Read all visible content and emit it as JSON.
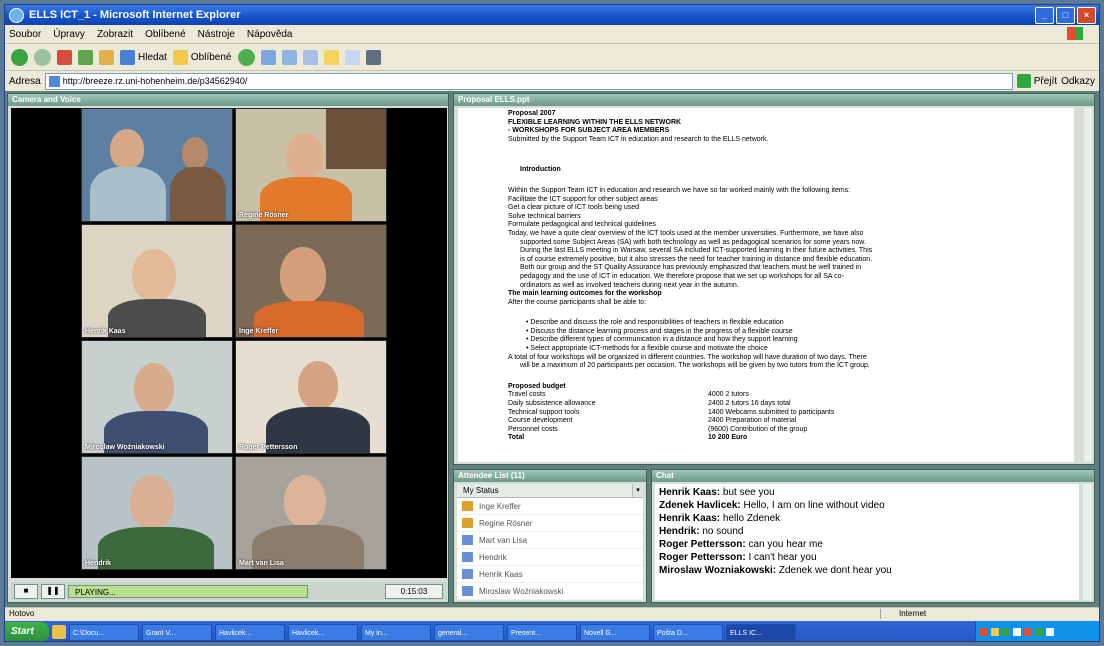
{
  "window": {
    "title": "ELLS ICT_1 - Microsoft Internet Explorer"
  },
  "menu": [
    "Soubor",
    "Úpravy",
    "Zobrazit",
    "Oblíbené",
    "Nástroje",
    "Nápověda"
  ],
  "toolbar": {
    "search_label": "Hledat",
    "favorites_label": "Oblíbené"
  },
  "address": {
    "label": "Adresa",
    "url": "http://breeze.rz.uni-hohenheim.de/p34562940/",
    "go_label": "Přejít",
    "links_label": "Odkazy"
  },
  "pods": {
    "camera": "Camera and Voice",
    "doc": "Proposal ELLS.ppt",
    "attendees": "Attendee List (11)",
    "chat": "Chat"
  },
  "cameras": [
    {
      "label": ""
    },
    {
      "label": "Regine Rösner"
    },
    {
      "label": "Henrik Kaas"
    },
    {
      "label": "Inge Kreffer"
    },
    {
      "label": "Miroslaw Woźniakowski"
    },
    {
      "label": "Roger Pettersson"
    },
    {
      "label": "Hendrik"
    },
    {
      "label": "Mart van Lisa"
    }
  ],
  "player": {
    "status": "PLAYING...",
    "time": "0:15:03"
  },
  "document": {
    "title_lines": [
      "Proposal 2007",
      "FLEXIBLE LEARNING WITHIN THE ELLS NETWORK",
      "- WORKSHOPS FOR SUBJECT AREA MEMBERS"
    ],
    "submitted": "Submitted by the Support Team ICT in education and research to the ELLS network.",
    "intro_heading": "Introduction",
    "intro_lines": [
      "Within the Support Team ICT in education and research we have so far worked mainly with the following items:",
      "Facilitate the ICT support for other subject areas",
      "Get a clear picture of ICT tools being used",
      "Solve technical barriers",
      "Formulate pedagogical and technical guidelines"
    ],
    "para_lines": [
      "Today, we have a quite clear overview of the ICT tools used at the member universities. Furthermore, we have also",
      "supported some Subject Areas (SA) with both technology as well as pedagogical scenarios for some years now.",
      "During the last ELLS meeting in Warsaw, several SA included ICT-supported learning in their future activities. This",
      "is of course extremely positive, but it also stresses the need for teacher training in distance and flexible education.",
      "Both our group and the ST Quality Assurance has previously emphasized that teachers must be well trained in",
      "pedagogy and the use of ICT in education. We therefore propose that we set up workshops for all SA co-",
      "ordinators as well as involved teachers during next year in the autumn."
    ],
    "outcomes_heading": "The main learning outcomes for the workshop",
    "outcomes_intro": "After the course participants shall be able to:",
    "bullets": [
      "• Describe and discuss the role and responsibilities of teachers in flexible education",
      "• Discuss the distance learning process and stages in the progress of a flexible course",
      "• Describe different types of communication in a distance and how they support learning",
      "• Select appropriate ICT-methods for a flexible course and motivate the choice"
    ],
    "total_workshops": "A total of four workshops will be organized in different countries. The workshop will have duration of two days. There",
    "total_workshops2": "will be a maximum of 20 participants per occasion. The workshops will be given by two tutors from the ICT group.",
    "budget_heading": "Proposed budget",
    "budget_rows": [
      [
        "Travel costs",
        "4000  2 tutors"
      ],
      [
        "Daily subsistence allowance",
        "2400  2 tutors 16 days total"
      ],
      [
        "Technical support tools",
        "1400  Webcams submitted to participants"
      ],
      [
        "Course development",
        "2400  Preparation of material"
      ],
      [
        "Personnel costs",
        "(9600) Contribution of the group"
      ],
      [
        "Total",
        "10 200 Euro"
      ]
    ]
  },
  "attendees": {
    "header": "My Status",
    "list": [
      "Inge Kreffer",
      "Regine Rösner",
      "Mart van Lisa",
      "Hendrik",
      "Henrik Kaas",
      "Miroslaw Woźniakowski"
    ]
  },
  "chat": [
    {
      "name": "Henrik Kaas:",
      "msg": " but see you"
    },
    {
      "name": "Zdenek Havlicek:",
      "msg": " Hello, I am on line without video"
    },
    {
      "name": "Henrik Kaas:",
      "msg": " hello Zdenek"
    },
    {
      "name": "Hendrik:",
      "msg": " no sound"
    },
    {
      "name": "Roger Pettersson:",
      "msg": " can you hear me"
    },
    {
      "name": "Roger Pettersson:",
      "msg": " I can't hear you"
    },
    {
      "name": "Miroslaw Wozniakowski:",
      "msg": " Zdenek we dont hear you"
    }
  ],
  "status": {
    "text": "Hotovo",
    "zone": "Internet"
  },
  "taskbar": {
    "start": "Start",
    "tasks": [
      "C:\\Docu...",
      "Grant V...",
      "Havlicek...",
      "Havlicek...",
      "My in...",
      "general...",
      "Present...",
      "Novell G...",
      "Pošta D...",
      "ELLS IC..."
    ]
  },
  "colors": {
    "accent": "#0f43ae",
    "pod_header": "#7fae9d",
    "background": "#5f7f7a"
  }
}
